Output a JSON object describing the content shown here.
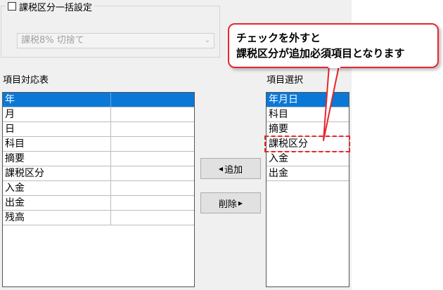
{
  "group": {
    "checkbox_label": "課税区分一括設定",
    "checked": false,
    "dropdown_value": "課税8%  切捨て"
  },
  "left_panel": {
    "label": "項目対応表",
    "rows": [
      "年",
      "月",
      "日",
      "科目",
      "摘要",
      "課税区分",
      "入金",
      "出金",
      "残高"
    ],
    "selected_index": 0
  },
  "right_panel": {
    "label": "項目選択",
    "items": [
      "年月日",
      "科目",
      "摘要",
      "課税区分",
      "入金",
      "出金"
    ],
    "selected_index": 0
  },
  "buttons": {
    "add_label": "追加",
    "delete_label": "削除"
  },
  "callout": {
    "line1": "チェックを外すと",
    "line2": "課税区分が追加必須項目となります",
    "color": "#e8262c"
  },
  "colors": {
    "selection": "#0a78d7",
    "accent_red": "#e8262c"
  }
}
